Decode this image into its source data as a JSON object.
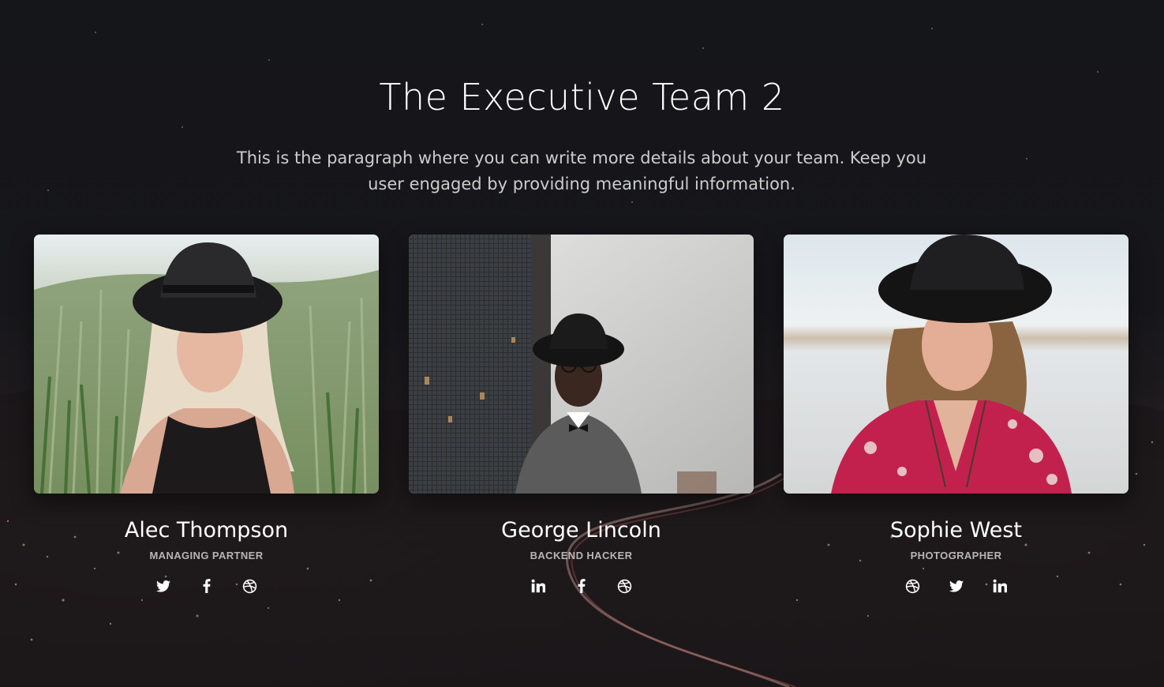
{
  "section": {
    "title": "The Executive Team 2",
    "description": "This is the paragraph where you can write more details about your team. Keep you user engaged by providing meaningful information."
  },
  "team": [
    {
      "name": "Alec Thompson",
      "role": "MANAGING PARTNER",
      "socials": [
        "twitter-icon",
        "facebook-icon",
        "dribbble-icon"
      ]
    },
    {
      "name": "George Lincoln",
      "role": "BACKEND HACKER",
      "socials": [
        "linkedin-icon",
        "facebook-icon",
        "dribbble-icon"
      ]
    },
    {
      "name": "Sophie West",
      "role": "PHOTOGRAPHER",
      "socials": [
        "dribbble-icon",
        "twitter-icon",
        "linkedin-icon"
      ]
    }
  ],
  "colors": {
    "background": "#141216",
    "text": "#ffffff",
    "muted_text": "#c4c4c4"
  }
}
